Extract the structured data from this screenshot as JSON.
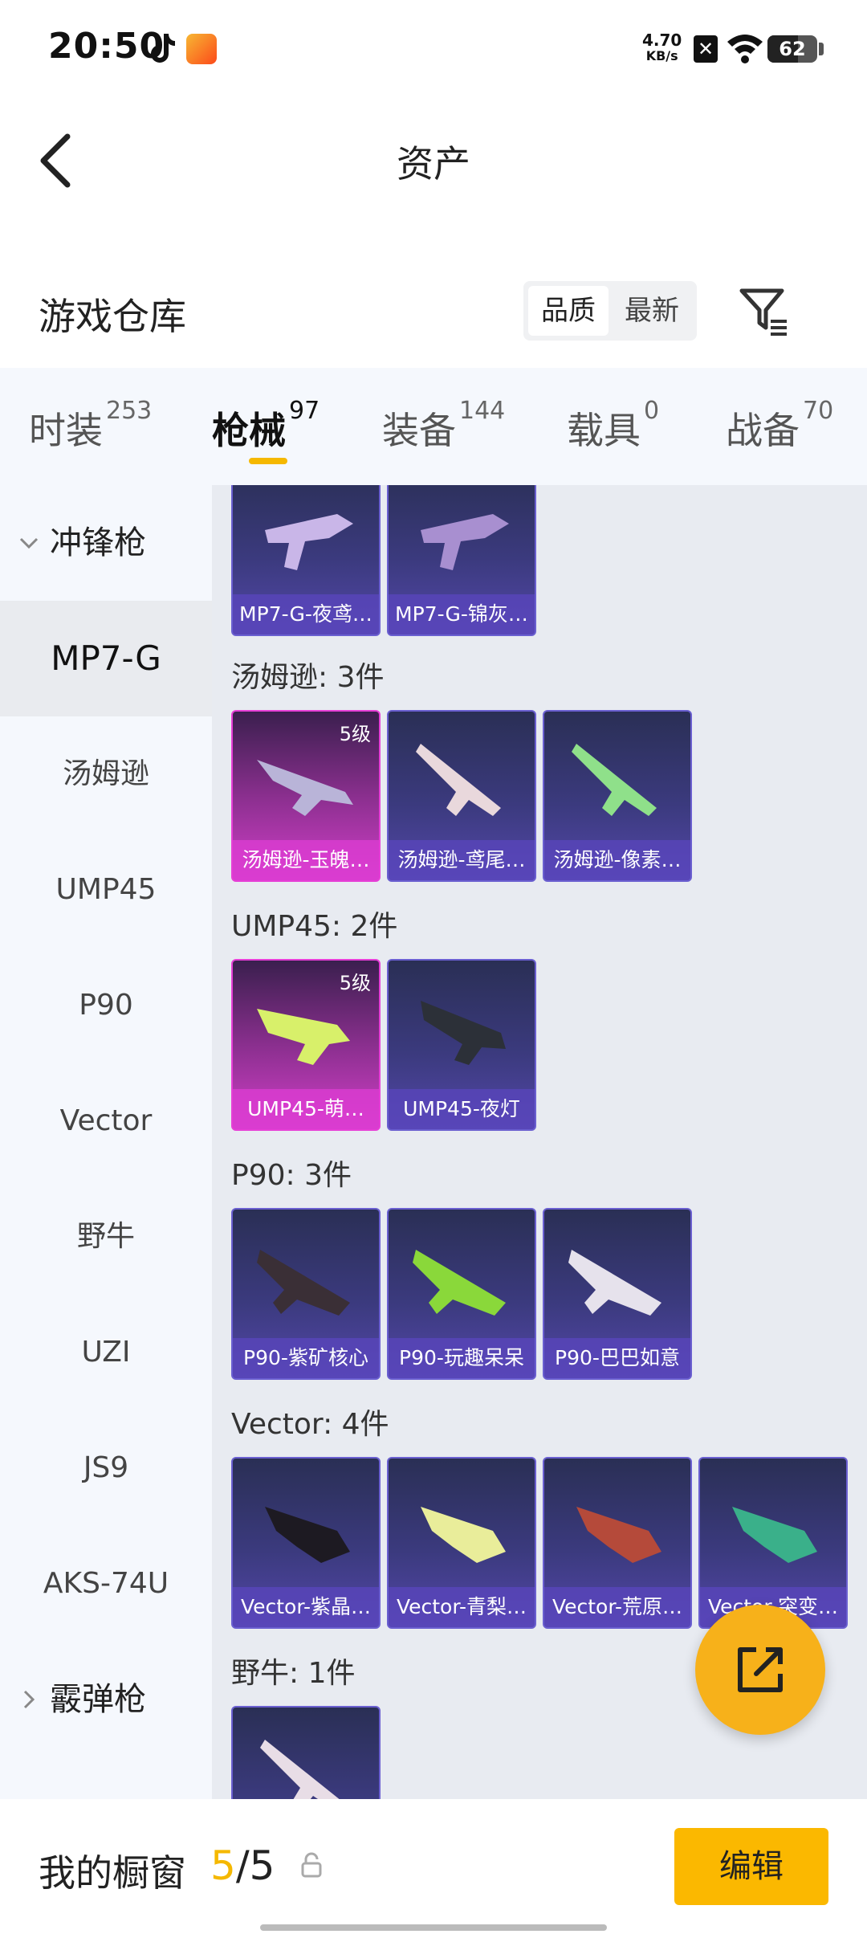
{
  "status_bar": {
    "time": "20:50",
    "net_speed_value": "4.70",
    "net_speed_unit": "KB/s",
    "battery": "62",
    "battery_level": 0.62
  },
  "header": {
    "title": "资产"
  },
  "section": {
    "title": "游戏仓库",
    "sort_options": [
      "品质",
      "最新"
    ],
    "active_sort": 0
  },
  "tabs": [
    {
      "label": "时装",
      "count": "253"
    },
    {
      "label": "枪械",
      "count": "97",
      "active": true
    },
    {
      "label": "装备",
      "count": "144"
    },
    {
      "label": "载具",
      "count": "0"
    },
    {
      "label": "战备",
      "count": "70"
    }
  ],
  "sidebar": {
    "group_open": "冲锋枪",
    "items": [
      "MP7-G",
      "汤姆逊",
      "UMP45",
      "P90",
      "Vector",
      "野牛",
      "UZI",
      "JS9",
      "AKS-74U"
    ],
    "active_item": "MP7-G",
    "group_closed": "霰弹枪"
  },
  "content": {
    "mp7_cards": [
      "MP7-G-夜鸢…",
      "MP7-G-锦灰…"
    ],
    "groups": [
      {
        "label": "汤姆逊: 3件",
        "cards": [
          {
            "name": "汤姆逊-玉魄…",
            "level": "5级",
            "gold": true
          },
          {
            "name": "汤姆逊-鸢尾…"
          },
          {
            "name": "汤姆逊-像素…"
          }
        ]
      },
      {
        "label": "UMP45: 2件",
        "cards": [
          {
            "name": "UMP45-萌…",
            "level": "5级",
            "gold": true
          },
          {
            "name": "UMP45-夜灯"
          }
        ]
      },
      {
        "label": "P90: 3件",
        "cards": [
          {
            "name": "P90-紫矿核心"
          },
          {
            "name": "P90-玩趣呆呆"
          },
          {
            "name": "P90-巴巴如意"
          }
        ]
      },
      {
        "label": "Vector: 4件",
        "cards": [
          {
            "name": "Vector-紫晶…"
          },
          {
            "name": "Vector-青梨…"
          },
          {
            "name": "Vector-荒原…"
          },
          {
            "name": "Vector-突变…"
          }
        ]
      },
      {
        "label": "野牛: 1件",
        "cards": [
          {
            "name": ""
          }
        ]
      }
    ]
  },
  "bottom": {
    "label": "我的橱窗",
    "count_current": "5",
    "count_sep": "/",
    "count_total": "5",
    "edit_label": "编辑"
  },
  "colors": {
    "accent": "#f5b800",
    "card_border": "#6a5fd0",
    "gold_border": "#e63fd6"
  }
}
